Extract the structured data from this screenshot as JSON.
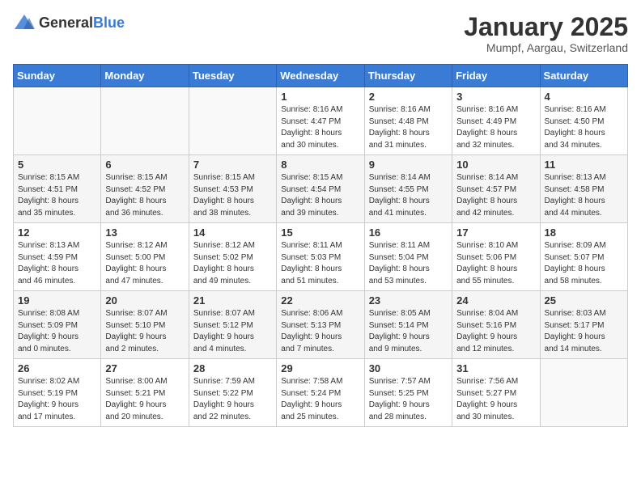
{
  "header": {
    "logo_general": "General",
    "logo_blue": "Blue",
    "title": "January 2025",
    "subtitle": "Mumpf, Aargau, Switzerland"
  },
  "weekdays": [
    "Sunday",
    "Monday",
    "Tuesday",
    "Wednesday",
    "Thursday",
    "Friday",
    "Saturday"
  ],
  "weeks": [
    [
      {
        "day": "",
        "info": ""
      },
      {
        "day": "",
        "info": ""
      },
      {
        "day": "",
        "info": ""
      },
      {
        "day": "1",
        "info": "Sunrise: 8:16 AM\nSunset: 4:47 PM\nDaylight: 8 hours\nand 30 minutes."
      },
      {
        "day": "2",
        "info": "Sunrise: 8:16 AM\nSunset: 4:48 PM\nDaylight: 8 hours\nand 31 minutes."
      },
      {
        "day": "3",
        "info": "Sunrise: 8:16 AM\nSunset: 4:49 PM\nDaylight: 8 hours\nand 32 minutes."
      },
      {
        "day": "4",
        "info": "Sunrise: 8:16 AM\nSunset: 4:50 PM\nDaylight: 8 hours\nand 34 minutes."
      }
    ],
    [
      {
        "day": "5",
        "info": "Sunrise: 8:15 AM\nSunset: 4:51 PM\nDaylight: 8 hours\nand 35 minutes."
      },
      {
        "day": "6",
        "info": "Sunrise: 8:15 AM\nSunset: 4:52 PM\nDaylight: 8 hours\nand 36 minutes."
      },
      {
        "day": "7",
        "info": "Sunrise: 8:15 AM\nSunset: 4:53 PM\nDaylight: 8 hours\nand 38 minutes."
      },
      {
        "day": "8",
        "info": "Sunrise: 8:15 AM\nSunset: 4:54 PM\nDaylight: 8 hours\nand 39 minutes."
      },
      {
        "day": "9",
        "info": "Sunrise: 8:14 AM\nSunset: 4:55 PM\nDaylight: 8 hours\nand 41 minutes."
      },
      {
        "day": "10",
        "info": "Sunrise: 8:14 AM\nSunset: 4:57 PM\nDaylight: 8 hours\nand 42 minutes."
      },
      {
        "day": "11",
        "info": "Sunrise: 8:13 AM\nSunset: 4:58 PM\nDaylight: 8 hours\nand 44 minutes."
      }
    ],
    [
      {
        "day": "12",
        "info": "Sunrise: 8:13 AM\nSunset: 4:59 PM\nDaylight: 8 hours\nand 46 minutes."
      },
      {
        "day": "13",
        "info": "Sunrise: 8:12 AM\nSunset: 5:00 PM\nDaylight: 8 hours\nand 47 minutes."
      },
      {
        "day": "14",
        "info": "Sunrise: 8:12 AM\nSunset: 5:02 PM\nDaylight: 8 hours\nand 49 minutes."
      },
      {
        "day": "15",
        "info": "Sunrise: 8:11 AM\nSunset: 5:03 PM\nDaylight: 8 hours\nand 51 minutes."
      },
      {
        "day": "16",
        "info": "Sunrise: 8:11 AM\nSunset: 5:04 PM\nDaylight: 8 hours\nand 53 minutes."
      },
      {
        "day": "17",
        "info": "Sunrise: 8:10 AM\nSunset: 5:06 PM\nDaylight: 8 hours\nand 55 minutes."
      },
      {
        "day": "18",
        "info": "Sunrise: 8:09 AM\nSunset: 5:07 PM\nDaylight: 8 hours\nand 58 minutes."
      }
    ],
    [
      {
        "day": "19",
        "info": "Sunrise: 8:08 AM\nSunset: 5:09 PM\nDaylight: 9 hours\nand 0 minutes."
      },
      {
        "day": "20",
        "info": "Sunrise: 8:07 AM\nSunset: 5:10 PM\nDaylight: 9 hours\nand 2 minutes."
      },
      {
        "day": "21",
        "info": "Sunrise: 8:07 AM\nSunset: 5:12 PM\nDaylight: 9 hours\nand 4 minutes."
      },
      {
        "day": "22",
        "info": "Sunrise: 8:06 AM\nSunset: 5:13 PM\nDaylight: 9 hours\nand 7 minutes."
      },
      {
        "day": "23",
        "info": "Sunrise: 8:05 AM\nSunset: 5:14 PM\nDaylight: 9 hours\nand 9 minutes."
      },
      {
        "day": "24",
        "info": "Sunrise: 8:04 AM\nSunset: 5:16 PM\nDaylight: 9 hours\nand 12 minutes."
      },
      {
        "day": "25",
        "info": "Sunrise: 8:03 AM\nSunset: 5:17 PM\nDaylight: 9 hours\nand 14 minutes."
      }
    ],
    [
      {
        "day": "26",
        "info": "Sunrise: 8:02 AM\nSunset: 5:19 PM\nDaylight: 9 hours\nand 17 minutes."
      },
      {
        "day": "27",
        "info": "Sunrise: 8:00 AM\nSunset: 5:21 PM\nDaylight: 9 hours\nand 20 minutes."
      },
      {
        "day": "28",
        "info": "Sunrise: 7:59 AM\nSunset: 5:22 PM\nDaylight: 9 hours\nand 22 minutes."
      },
      {
        "day": "29",
        "info": "Sunrise: 7:58 AM\nSunset: 5:24 PM\nDaylight: 9 hours\nand 25 minutes."
      },
      {
        "day": "30",
        "info": "Sunrise: 7:57 AM\nSunset: 5:25 PM\nDaylight: 9 hours\nand 28 minutes."
      },
      {
        "day": "31",
        "info": "Sunrise: 7:56 AM\nSunset: 5:27 PM\nDaylight: 9 hours\nand 30 minutes."
      },
      {
        "day": "",
        "info": ""
      }
    ]
  ]
}
